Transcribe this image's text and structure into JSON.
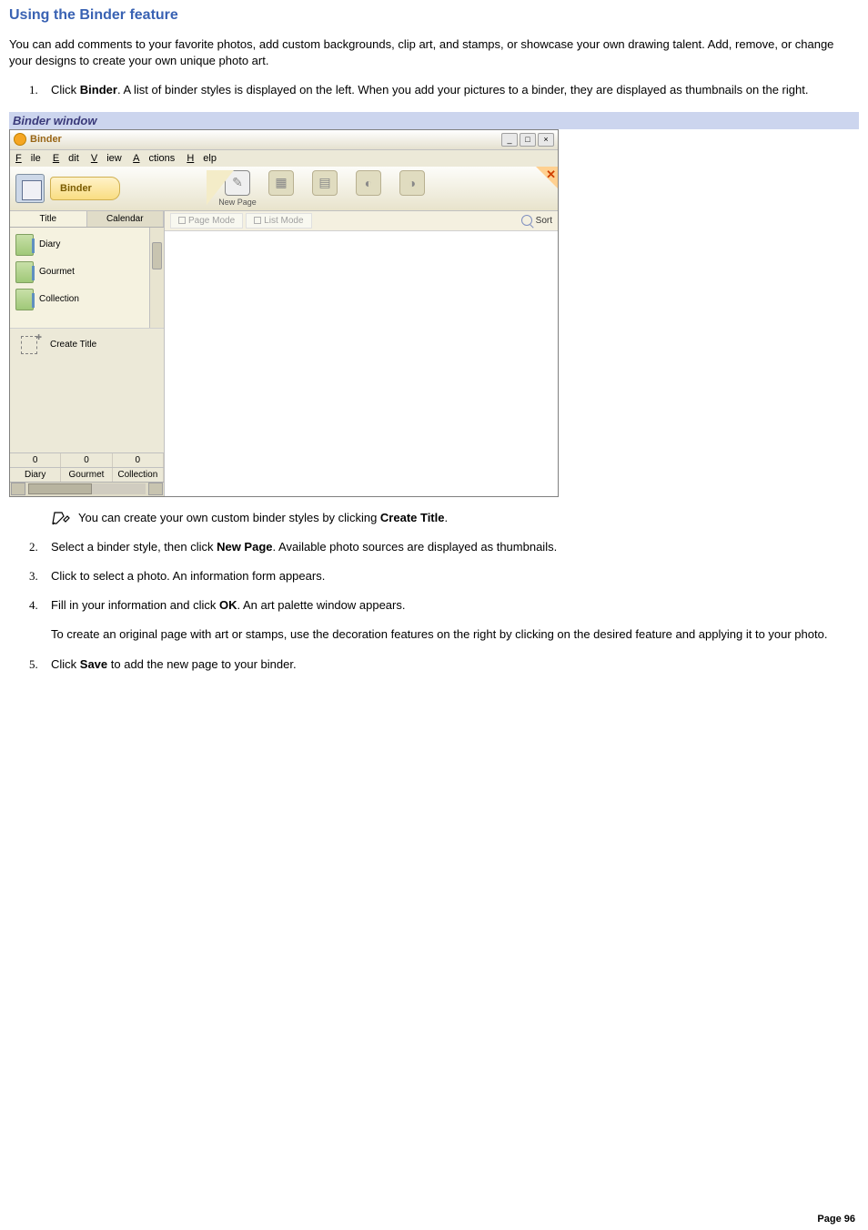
{
  "doc": {
    "title": "Using the Binder feature",
    "intro": "You can add comments to your favorite photos, add custom backgrounds, clip art, and stamps, or showcase your own drawing talent. Add, remove, or change your designs to create your own unique photo art.",
    "page_label": "Page 96"
  },
  "steps": {
    "s1_a": "Click ",
    "s1_b": "Binder",
    "s1_c": ". A list of binder styles is displayed on the left. When you add your pictures to a binder, they are displayed as thumbnails on the right.",
    "caption": "Binder window",
    "note_a": "You can create your own custom binder styles by clicking ",
    "note_b": "Create Title",
    "note_c": ".",
    "s2_a": "Select a binder style, then click ",
    "s2_b": "New Page",
    "s2_c": ". Available photo sources are displayed as thumbnails.",
    "s3": "Click to select a photo. An information form appears.",
    "s4_a": "Fill in your information and click ",
    "s4_b": "OK",
    "s4_c": ". An art palette window appears.",
    "s4_p2": "To create an original page with art or stamps, use the decoration features on the right by clicking on the desired feature and applying it to your photo.",
    "s5_a": "Click ",
    "s5_b": "Save",
    "s5_c": " to add the new page to your binder."
  },
  "win": {
    "title": "Binder",
    "menus": {
      "file": "File",
      "edit": "Edit",
      "view": "View",
      "actions": "Actions",
      "help": "Help"
    },
    "binder_label": "Binder",
    "newpage": "New Page",
    "tabs": {
      "title": "Title",
      "calendar": "Calendar"
    },
    "styles": {
      "diary": "Diary",
      "gourmet": "Gourmet",
      "collection": "Collection"
    },
    "create_title": "Create Title",
    "counts": {
      "c1": "0",
      "c2": "0",
      "c3": "0"
    },
    "count_labels": {
      "l1": "Diary",
      "l2": "Gourmet",
      "l3": "Collection"
    },
    "modes": {
      "page": "Page Mode",
      "list": "List Mode",
      "sort": "Sort"
    }
  }
}
